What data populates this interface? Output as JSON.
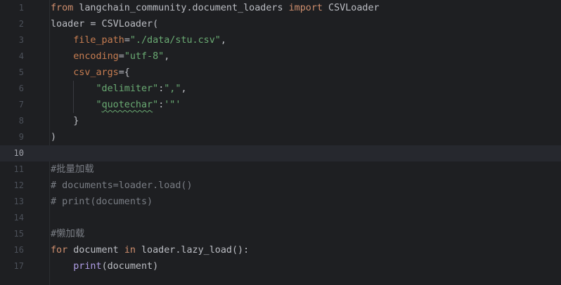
{
  "editor": {
    "current_line": 10,
    "lines": [
      {
        "n": "1",
        "tokens": [
          {
            "t": "from",
            "c": "kw"
          },
          {
            "t": " langchain_community.document_loaders ",
            "c": ""
          },
          {
            "t": "import",
            "c": "kw"
          },
          {
            "t": " CSVLoader",
            "c": ""
          }
        ]
      },
      {
        "n": "2",
        "tokens": [
          {
            "t": "loader = CSVLoader(",
            "c": ""
          }
        ]
      },
      {
        "n": "3",
        "tokens": [
          {
            "t": "    ",
            "c": ""
          },
          {
            "t": "file_path",
            "c": "param"
          },
          {
            "t": "=",
            "c": ""
          },
          {
            "t": "\"./data/stu.csv\"",
            "c": "str"
          },
          {
            "t": ",",
            "c": ""
          }
        ]
      },
      {
        "n": "4",
        "tokens": [
          {
            "t": "    ",
            "c": ""
          },
          {
            "t": "encoding",
            "c": "param"
          },
          {
            "t": "=",
            "c": ""
          },
          {
            "t": "\"utf-8\"",
            "c": "str"
          },
          {
            "t": ",",
            "c": ""
          }
        ]
      },
      {
        "n": "5",
        "tokens": [
          {
            "t": "    ",
            "c": ""
          },
          {
            "t": "csv_args",
            "c": "param"
          },
          {
            "t": "={",
            "c": ""
          }
        ]
      },
      {
        "n": "6",
        "tokens": [
          {
            "t": "        ",
            "c": ""
          },
          {
            "t": "\"delimiter\"",
            "c": "str"
          },
          {
            "t": ":",
            "c": ""
          },
          {
            "t": "\",\"",
            "c": "str"
          },
          {
            "t": ",",
            "c": ""
          }
        ]
      },
      {
        "n": "7",
        "tokens": [
          {
            "t": "        ",
            "c": ""
          },
          {
            "t": "\"",
            "c": "str"
          },
          {
            "t": "quotechar",
            "c": "str typo"
          },
          {
            "t": "\"",
            "c": "str"
          },
          {
            "t": ":",
            "c": ""
          },
          {
            "t": "'\"'",
            "c": "str"
          }
        ]
      },
      {
        "n": "8",
        "tokens": [
          {
            "t": "    }",
            "c": ""
          }
        ]
      },
      {
        "n": "9",
        "tokens": [
          {
            "t": ")",
            "c": ""
          }
        ]
      },
      {
        "n": "10",
        "tokens": []
      },
      {
        "n": "11",
        "tokens": [
          {
            "t": "#批量加载",
            "c": "comment"
          }
        ]
      },
      {
        "n": "12",
        "tokens": [
          {
            "t": "# documents=loader.load()",
            "c": "comment"
          }
        ]
      },
      {
        "n": "13",
        "tokens": [
          {
            "t": "# print(documents)",
            "c": "comment"
          }
        ]
      },
      {
        "n": "14",
        "tokens": []
      },
      {
        "n": "15",
        "tokens": [
          {
            "t": "#懒加载",
            "c": "comment"
          }
        ]
      },
      {
        "n": "16",
        "tokens": [
          {
            "t": "for",
            "c": "kw"
          },
          {
            "t": " document ",
            "c": ""
          },
          {
            "t": "in",
            "c": "kw"
          },
          {
            "t": " loader.lazy_load():",
            "c": ""
          }
        ]
      },
      {
        "n": "17",
        "tokens": [
          {
            "t": "    ",
            "c": ""
          },
          {
            "t": "print",
            "c": "fn"
          },
          {
            "t": "(document)",
            "c": ""
          }
        ]
      }
    ]
  }
}
